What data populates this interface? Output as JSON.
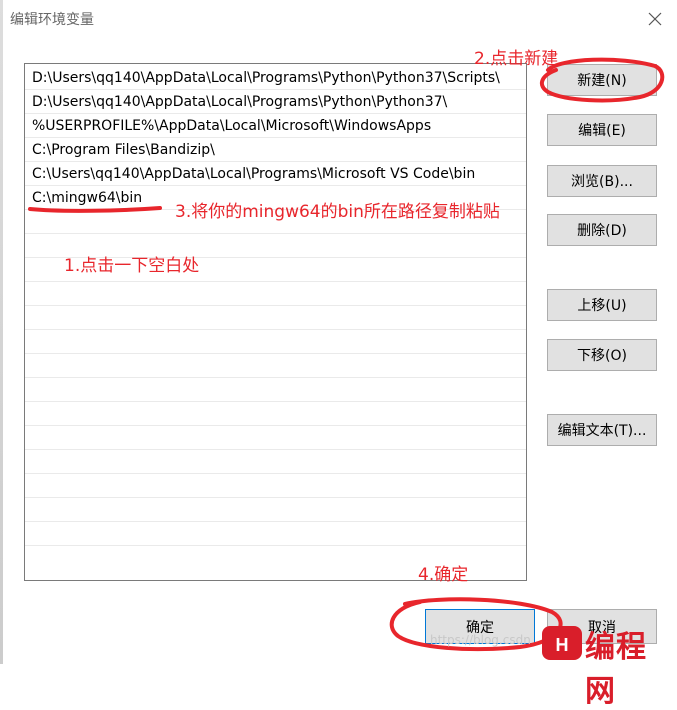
{
  "window": {
    "title": "编辑环境变量"
  },
  "list": {
    "items": [
      "D:\\Users\\qq140\\AppData\\Local\\Programs\\Python\\Python37\\Scripts\\",
      "D:\\Users\\qq140\\AppData\\Local\\Programs\\Python\\Python37\\",
      "%USERPROFILE%\\AppData\\Local\\Microsoft\\WindowsApps",
      "C:\\Program Files\\Bandizip\\",
      "C:\\Users\\qq140\\AppData\\Local\\Programs\\Microsoft VS Code\\bin",
      "C:\\mingw64\\bin"
    ]
  },
  "buttons": {
    "new": "新建(N)",
    "edit": "编辑(E)",
    "browse": "浏览(B)...",
    "delete": "删除(D)",
    "move_up": "上移(U)",
    "move_down": "下移(O)",
    "edit_text": "编辑文本(T)...",
    "ok": "确定",
    "cancel": "取消"
  },
  "annotations": {
    "step1": "1.点击一下空白处",
    "step2": "2.点击新建",
    "step3": "3.将你的mingw64的bin所在路径复制粘贴",
    "step4": "4.确定"
  },
  "watermark": {
    "site_text": "https://blog.csdn",
    "logo_text": "编程网"
  },
  "colors": {
    "annotation_red": "#e8262c",
    "button_bg": "#e1e1e1",
    "button_border": "#adadad",
    "list_border": "#7a7a7a"
  }
}
